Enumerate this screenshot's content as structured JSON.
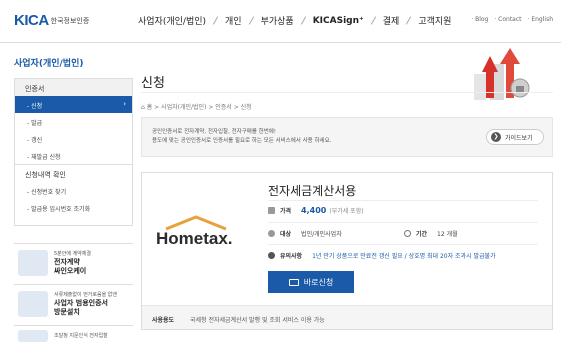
{
  "header": {
    "logo_text_kica": "KICA",
    "logo_text_name": "한국정보인증",
    "nav": [
      "사업자(개인/법인)",
      "개인",
      "부가상품",
      "KICASign⁺",
      "결제",
      "고객지원"
    ],
    "util": [
      "· Blog",
      "· Contact",
      "· English"
    ]
  },
  "sidebar": {
    "title": "사업자(개인/법인)",
    "section1": "인증서",
    "active_item": "- 신청",
    "items": [
      "- 발급",
      "- 갱신",
      "- 재발급 신청"
    ],
    "section2": "신청내역 확인",
    "items2": [
      "- 신청번호 찾기",
      "- 발급용 임시번호 조기화"
    ]
  },
  "promos": [
    {
      "small": "5분안에 계약체결",
      "big1": "전자계약",
      "big2": "싸인오케이"
    },
    {
      "small": "서류제출없이 번거로움을 없앤",
      "big1": "사업자 범용인증서",
      "big2": "방문설치"
    },
    {
      "small": "조달청 지문인식 전자입찰"
    }
  ],
  "main": {
    "title": "신청",
    "breadcrumb": "⌂ 홈  >  사업자(개인/법인)  >  인증서  >  신청",
    "info_line1": "공인인증서로 전자계약, 전자입찰, 전자구매를 한번에!",
    "info_line2": "용도에 맞는 공인인증서로 인증서를 필요로 하는 모든 서비스에서 사용 하세요.",
    "guide_btn": "가이드보기",
    "guide_icon": "❯",
    "product": {
      "name": "전자세금계산서용",
      "brand": "Hometax.",
      "price_label": "가격",
      "price": "4,400",
      "price_note": "(부가세 포함)",
      "target_label": "대상",
      "target": "법인/개인사업자",
      "period_label": "기간",
      "period": "12 개월",
      "notice_label": "유의사항",
      "notice": "1년 만기 상품으로 만료전 갱신 필요 / 상호명 최대 20자 조과시 발급불가",
      "apply": "바로신청",
      "usage_label": "사용용도",
      "usage": "국세청 전자세금계산서 발행 및 조회 서비스 이용 가능"
    }
  }
}
